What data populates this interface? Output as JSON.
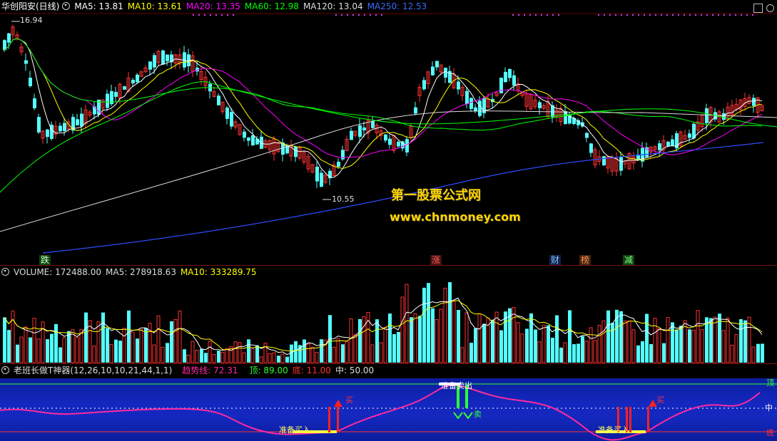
{
  "main": {
    "title": "华创阳安(日线)",
    "ma_labels": [
      {
        "text": "MA5: 13.81",
        "color": "#ffffff"
      },
      {
        "text": "MA10: 13.61",
        "color": "#ffff00"
      },
      {
        "text": "MA20: 13.35",
        "color": "#ff00ff"
      },
      {
        "text": "MA60: 12.98",
        "color": "#00ff00"
      },
      {
        "text": "MA120: 13.04",
        "color": "#dcdcdc"
      },
      {
        "text": "MA250: 12.53",
        "color": "#3a6bff"
      }
    ],
    "high_label": "16.94",
    "low_label": "10.55",
    "watermark_cn": "第一股票公式网",
    "watermark_url": "www.chnmoney.com",
    "events": [
      {
        "text": "跌",
        "color": "#c8ffc8",
        "bg": "#114411"
      },
      {
        "text": "涨",
        "color": "#ff6060",
        "bg": "#441111"
      },
      {
        "text": "财",
        "color": "#80c0ff",
        "bg": "#112244"
      },
      {
        "text": "榜",
        "color": "#ff9050",
        "bg": "#442211"
      },
      {
        "text": "减",
        "color": "#80ff80",
        "bg": "#114411"
      }
    ],
    "icons": [
      "maximize-icon",
      "settings-icon"
    ]
  },
  "volume": {
    "labels": [
      {
        "text": "VOLUME: 172488.00",
        "color": "#dddddd"
      },
      {
        "text": "MA5: 278918.63",
        "color": "#dddddd"
      },
      {
        "text": "MA10: 333289.75",
        "color": "#ffff00"
      }
    ]
  },
  "indicator": {
    "name": "老班长做T神器(12,26,10,10,21,44,1,1)",
    "trend_label": "趋势线: 72.31",
    "top_label": "顶: 89.00",
    "bottom_label": "底: 11.00",
    "mid_label": "中: 50.00",
    "axis_top": "顶",
    "axis_mid": "中",
    "axis_bottom": "底",
    "signals": [
      {
        "text": "准备买入",
        "color": "#ffff60"
      },
      {
        "text": "准备卖出",
        "color": "#ffffff"
      },
      {
        "text": "准备买入",
        "color": "#ffff60"
      }
    ],
    "buy_marks": [
      {
        "text": "买",
        "color": "#ff3030"
      },
      {
        "text": "买",
        "color": "#ff3030"
      }
    ],
    "sell_mark": {
      "text": "卖",
      "color": "#30ff30"
    }
  },
  "colors": {
    "up": "#ff3232",
    "down": "#54ffff",
    "ma5": "#ffffff",
    "ma10": "#ffff00",
    "ma20": "#ff00ff",
    "ma60": "#00ff00",
    "ma120": "#dcdcdc",
    "ma250": "#2f4cff",
    "trend": "#ff2aa0"
  }
}
